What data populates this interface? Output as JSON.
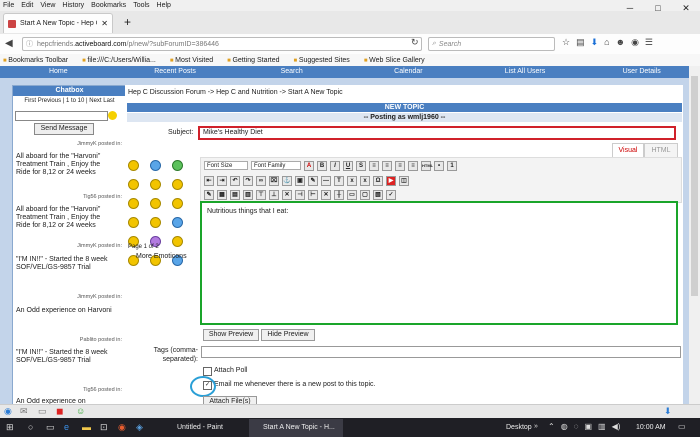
{
  "browser": {
    "menu": [
      "File",
      "Edit",
      "View",
      "History",
      "Bookmarks",
      "Tools",
      "Help"
    ],
    "tab_title": "Start A New Topic - Hep C...",
    "url_prefix": "hepcfriends.",
    "url_domain": "activeboard.com",
    "url_suffix": "/p/new/?subForumID=386446",
    "search_placeholder": "Search",
    "bookmarks": [
      "Bookmarks Toolbar",
      "file:///C:/Users/Willia...",
      "Most Visited",
      "Getting Started",
      "Suggested Sites",
      "Web Slice Gallery"
    ]
  },
  "site_nav": [
    "Home",
    "Recent Posts",
    "Search",
    "Calendar",
    "List All Users",
    "User Details"
  ],
  "chatbox": {
    "header": "Chatbox",
    "pagination": "First Previous | 1 to 10 | Next Last",
    "send_label": "Send Message",
    "messages": [
      {
        "meta": "JimmyK posted in:",
        "text": "All aboard for the \"Harvoni\" Treatment Train , Enjoy the Ride for 8,12 or 24 weeks"
      },
      {
        "meta": "Tig56 posted in:",
        "text": "All aboard for the \"Harvoni\" Treatment Train , Enjoy the Ride for 8,12 or 24 weeks"
      },
      {
        "meta": "JimmyK posted in:",
        "text": "\"I'M IN!!\" - Started the 8 week SOF/VEL/GS-9857 Trial"
      },
      {
        "meta": "JimmyK posted in:",
        "text": "An Odd experience on Harvoni"
      },
      {
        "meta": "Pablito posted in:",
        "text": "\"I'M IN!!\" - Started the 8 week SOF/VEL/GS-9857 Trial"
      },
      {
        "meta": "Tig56 posted in:",
        "text": "An Odd experience on"
      }
    ]
  },
  "main": {
    "breadcrumb": "Hep C Discussion Forum -> Hep C and Nutrition -> Start A New Topic",
    "header": "NEW TOPIC",
    "posting_as": "-- Posting as wmlj1960 --",
    "subject_label": "Subject:",
    "subject_value": "Mike's Healthy Diet",
    "tab_visual": "Visual",
    "tab_html": "HTML",
    "font_size": "Font Size",
    "font_family": "Font Family",
    "emoticon_page": "Page 1 of 2",
    "more_emoticons": "More Emoticons",
    "editor_text": "Nutritious things that I eat:",
    "show_preview": "Show Preview",
    "hide_preview": "Hide Preview",
    "tags_label": "Tags (comma-separated):",
    "attach_poll": "Attach Poll",
    "email_notify": "Email me whenever there is a new post to this topic.",
    "attach_files": "Attach File(s)"
  },
  "taskbar": {
    "item_paint": "Untitled - Paint",
    "item_firefox": "Start A New Topic - H...",
    "desktop": "Desktop",
    "time": "10:00 AM"
  },
  "colors": {
    "nav_blue": "#4a7fc1",
    "page_bg": "#c3d4ea",
    "subject_highlight": "#d0212a",
    "editor_highlight": "#1aa52a",
    "circle_highlight": "#2a9fd6"
  }
}
